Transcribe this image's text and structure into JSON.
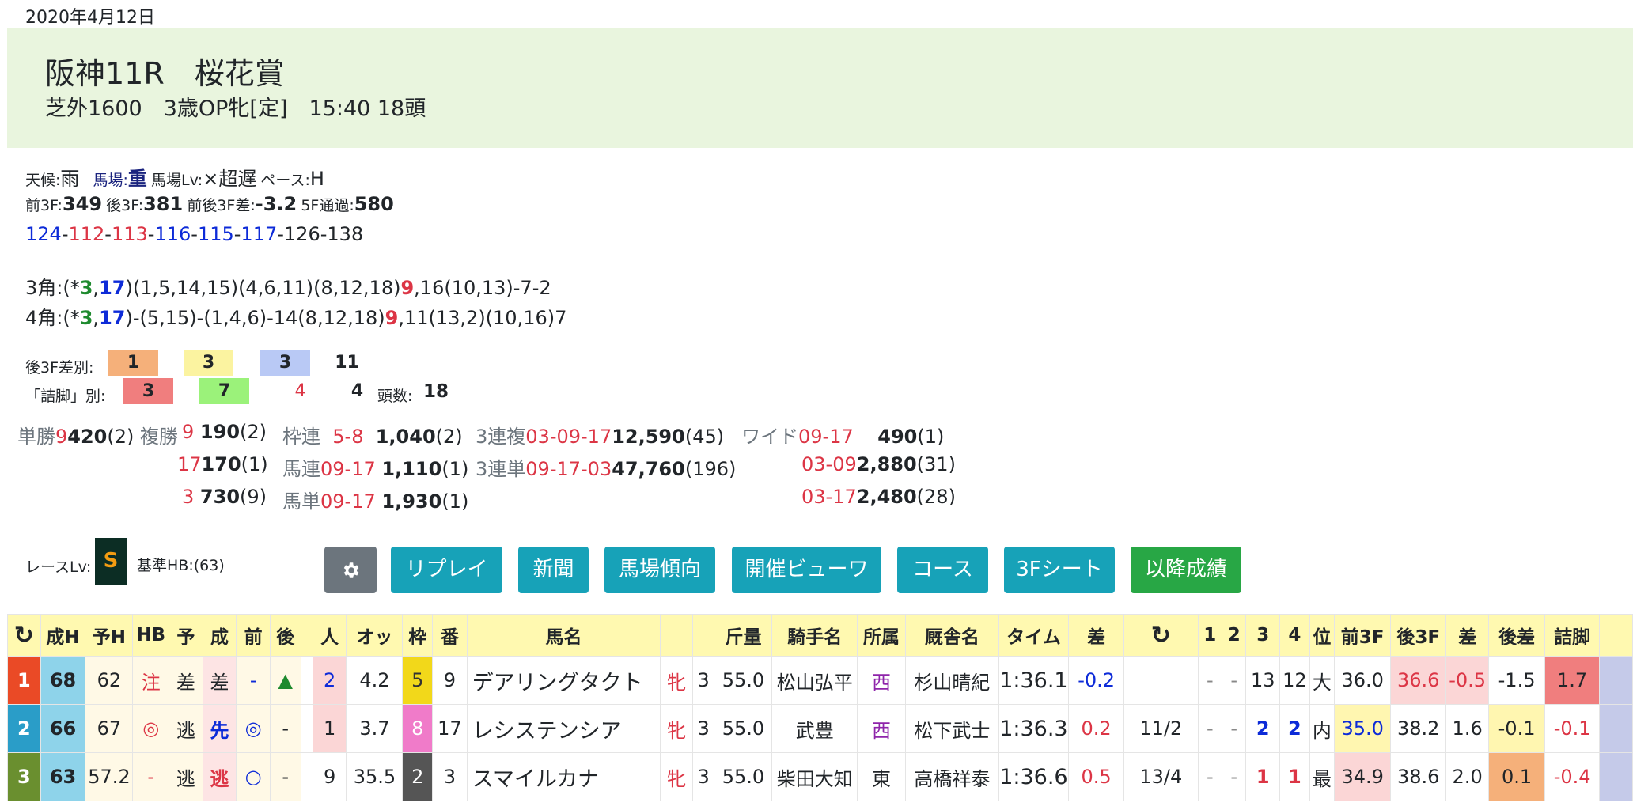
{
  "date": "2020年4月12日",
  "race": {
    "title": "阪神11R　桜花賞",
    "sub": "芝外1600　3歳OP牝[定]　15:40 18頭"
  },
  "conditions": {
    "weather_label": "天候:",
    "weather": "雨",
    "track_label": "馬場:",
    "track": "重",
    "track_lv_label": "馬場Lv:",
    "track_lv": "×超遅",
    "pace_label": "ペース:",
    "pace": "H"
  },
  "times": {
    "f3_label": "前3F:",
    "f3": "349",
    "l3_label": "後3F:",
    "l3": "381",
    "diff_label": "前後3F差:",
    "diff": "-3.2",
    "f5_label": "5F通過:",
    "f5": "580"
  },
  "laps": [
    {
      "v": "124",
      "c": "blue"
    },
    {
      "v": "112",
      "c": "red"
    },
    {
      "v": "113",
      "c": "red"
    },
    {
      "v": "116",
      "c": "blue"
    },
    {
      "v": "115",
      "c": "blue"
    },
    {
      "v": "117",
      "c": "blue"
    },
    {
      "v": "126",
      "c": ""
    },
    {
      "v": "138",
      "c": ""
    }
  ],
  "corners": {
    "c3_label": "3角:(*",
    "c3_a": "3",
    "c3_sep": ",",
    "c3_b": "17",
    "c3_mid": ")(1,5,14,15)(4,6,11)(8,12,18)",
    "c3_c": "9",
    "c3_rest": ",16(10,13)-7-2",
    "c4_label": "4角:(*",
    "c4_a": "3",
    "c4_sep": ",",
    "c4_b": "17",
    "c4_mid": ")-(5,15)-(1,4,6)-14(8,12,18)",
    "c4_c": "9",
    "c4_rest": ",11(13,2)(10,16)7"
  },
  "l3_split": {
    "label": "後3F差別:",
    "values": [
      "1",
      "3",
      "3",
      "11"
    ]
  },
  "tsume": {
    "label": "「詰脚」別:",
    "values": [
      "3",
      "7",
      "4",
      "4"
    ],
    "count_label": "頭数:",
    "count": "18"
  },
  "payouts": {
    "tansho_label": "単勝",
    "tansho_num": "9",
    "tansho_amt": "420",
    "tansho_pop": "(2)",
    "fukusho_label": "複勝",
    "fukusho": [
      {
        "num": "9",
        "amt": "190",
        "pop": "(2)"
      },
      {
        "num": "17",
        "amt": "170",
        "pop": "(1)"
      },
      {
        "num": "3",
        "amt": "730",
        "pop": "(9)"
      }
    ],
    "wakuren_label": "枠連",
    "wakuren_num": "5-8",
    "wakuren_amt": "1,040",
    "wakuren_pop": "(2)",
    "umaren_label": "馬連",
    "umaren_num": "09-17",
    "umaren_amt": "1,110",
    "umaren_pop": "(1)",
    "umatan_label": "馬単",
    "umatan_num": "09-17",
    "umatan_amt": "1,930",
    "umatan_pop": "(1)",
    "sanrenpuku_label": "3連複",
    "sanrenpuku_num": "03-09-17",
    "sanrenpuku_amt": "12,590",
    "sanrenpuku_pop": "(45)",
    "sanrentan_label": "3連単",
    "sanrentan_num": "09-17-03",
    "sanrentan_amt": "47,760",
    "sanrentan_pop": "(196)",
    "wide_label": "ワイド",
    "wide": [
      {
        "num": "09-17",
        "amt": "490",
        "pop": "(1)"
      },
      {
        "num": "03-09",
        "amt": "2,880",
        "pop": "(31)"
      },
      {
        "num": "03-17",
        "amt": "2,480",
        "pop": "(28)"
      }
    ]
  },
  "race_lv": {
    "label": "レースLv:",
    "value": "S",
    "hb": "基準HB:(63)"
  },
  "buttons": {
    "settings_icon": "gear-icon",
    "replay": "リプレイ",
    "newspaper": "新聞",
    "track_trend": "馬場傾向",
    "viewer": "開催ビューワ",
    "course": "コース",
    "sheet": "3Fシート",
    "later": "以降成績"
  },
  "table": {
    "headers": [
      "↻",
      "成H",
      "予H",
      "HB",
      "予",
      "成",
      "前",
      "後",
      "",
      "人",
      "オッ",
      "枠",
      "番",
      "馬名",
      "",
      "",
      "斤量",
      "騎手名",
      "所属",
      "厩舎名",
      "タイム",
      "差",
      "↻",
      "1",
      "2",
      "3",
      "4",
      "位",
      "前3F",
      "後3F",
      "差",
      "後差",
      "詰脚",
      ""
    ],
    "rows": [
      [
        "1",
        "68",
        "62",
        "注",
        "差",
        "差",
        "-",
        "▲",
        "",
        "2",
        "4.2",
        "5",
        "9",
        "デアリングタクト",
        "牝",
        "3",
        "55.0",
        "松山弘平",
        "西",
        "杉山晴紀",
        "1:36.1",
        "-0.2",
        "",
        "-",
        "-",
        "13",
        "12",
        "大",
        "36.0",
        "36.6",
        "-0.5",
        "-1.5",
        "1.7",
        ""
      ],
      [
        "2",
        "66",
        "67",
        "◎",
        "逃",
        "先",
        "◎",
        "-",
        "",
        "1",
        "3.7",
        "8",
        "17",
        "レシステンシア",
        "牝",
        "3",
        "55.0",
        "武豊",
        "西",
        "松下武士",
        "1:36.3",
        "0.2",
        "11/2",
        "-",
        "-",
        "2",
        "2",
        "内",
        "35.0",
        "38.2",
        "1.6",
        "-0.1",
        "-0.1",
        ""
      ],
      [
        "3",
        "63",
        "57.2",
        "-",
        "逃",
        "逃",
        "○",
        "-",
        "",
        "9",
        "35.5",
        "2",
        "3",
        "スマイルカナ",
        "牝",
        "3",
        "55.0",
        "柴田大知",
        "東",
        "高橋祥泰",
        "1:36.6",
        "0.5",
        "13/4",
        "-",
        "-",
        "1",
        "1",
        "最",
        "34.9",
        "38.6",
        "2.0",
        "0.1",
        "-0.4",
        ""
      ]
    ]
  },
  "colors": {
    "header_bg": "#e9f5de",
    "table_header": "#fff9b0",
    "teal": "#17a2b8",
    "green_btn": "#28a745"
  }
}
